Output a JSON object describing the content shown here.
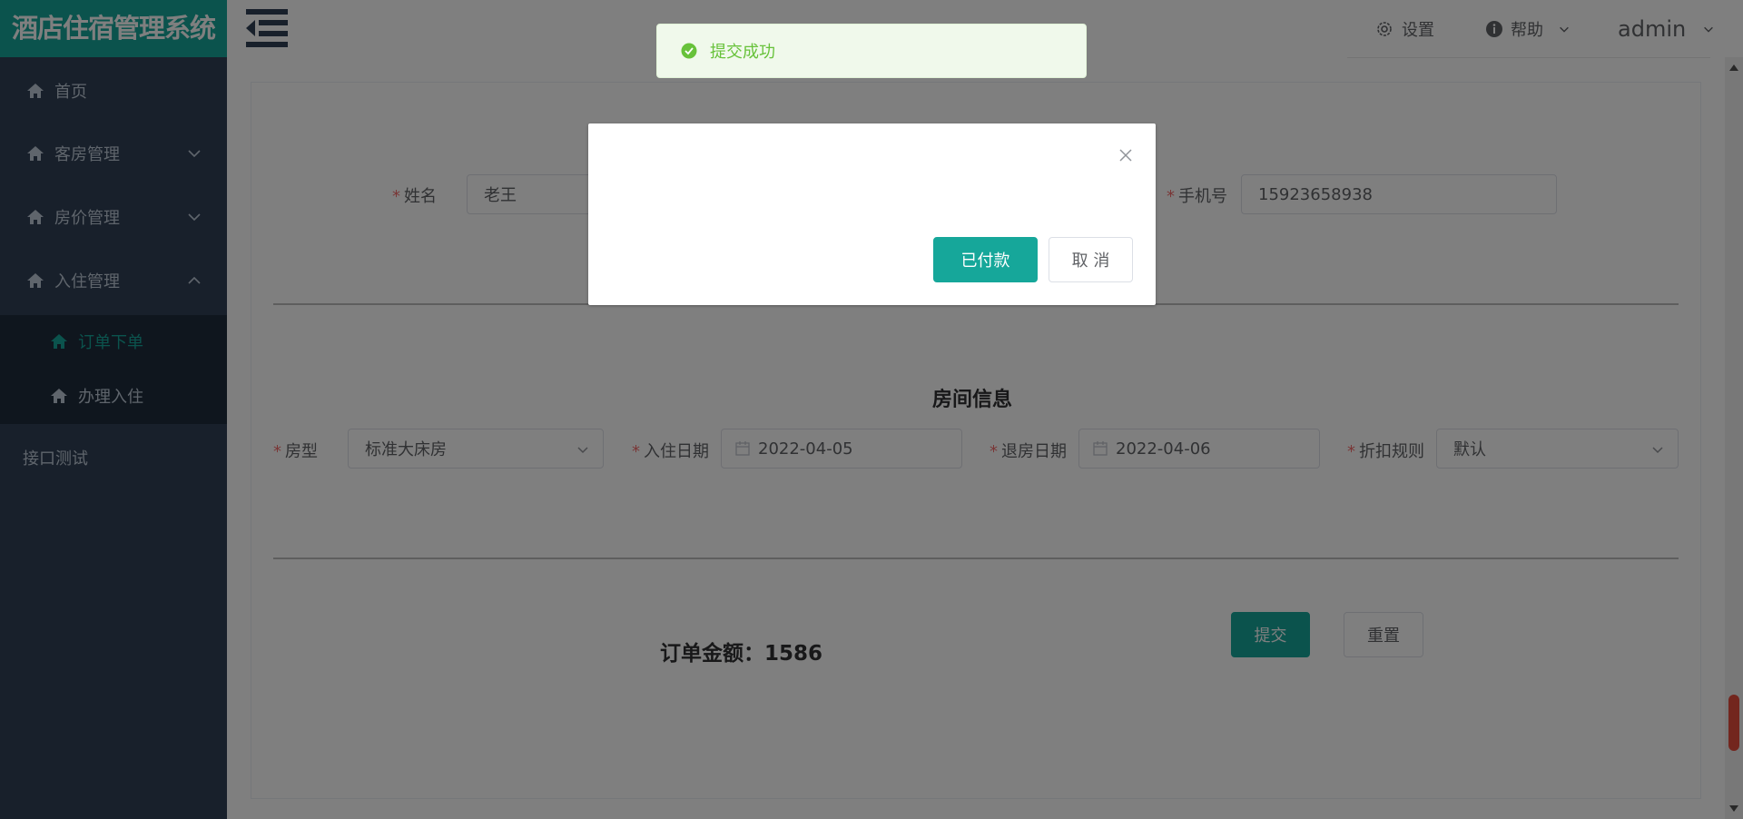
{
  "app": {
    "title": "酒店住宿管理系统"
  },
  "sidebar": {
    "items": [
      {
        "label": "首页"
      },
      {
        "label": "客房管理"
      },
      {
        "label": "房价管理"
      },
      {
        "label": "入住管理"
      },
      {
        "label": "订单下单"
      },
      {
        "label": "办理入住"
      },
      {
        "label": "接口测试"
      }
    ]
  },
  "header": {
    "settings": "设置",
    "help": "帮助",
    "user": "admin"
  },
  "message": {
    "text": "提交成功"
  },
  "dialog": {
    "confirm_label": "已付款",
    "cancel_label": "取 消"
  },
  "form": {
    "name_label": "姓名",
    "name_value": "老王",
    "phone_label": "手机号",
    "phone_value": "15923658938",
    "room_section_title": "房间信息",
    "room_type_label": "房型",
    "room_type_value": "标准大床房",
    "checkin_label": "入住日期",
    "checkin_value": "2022-04-05",
    "checkout_label": "退房日期",
    "checkout_value": "2022-04-06",
    "discount_label": "折扣规则",
    "discount_value": "默认",
    "amount_text": "订单金额：1586",
    "submit_label": "提交",
    "reset_label": "重置"
  },
  "colors": {
    "brand": "#16a79a",
    "sidebar_bg": "#304156",
    "success": "#67c23a",
    "required": "#f56c6c"
  }
}
